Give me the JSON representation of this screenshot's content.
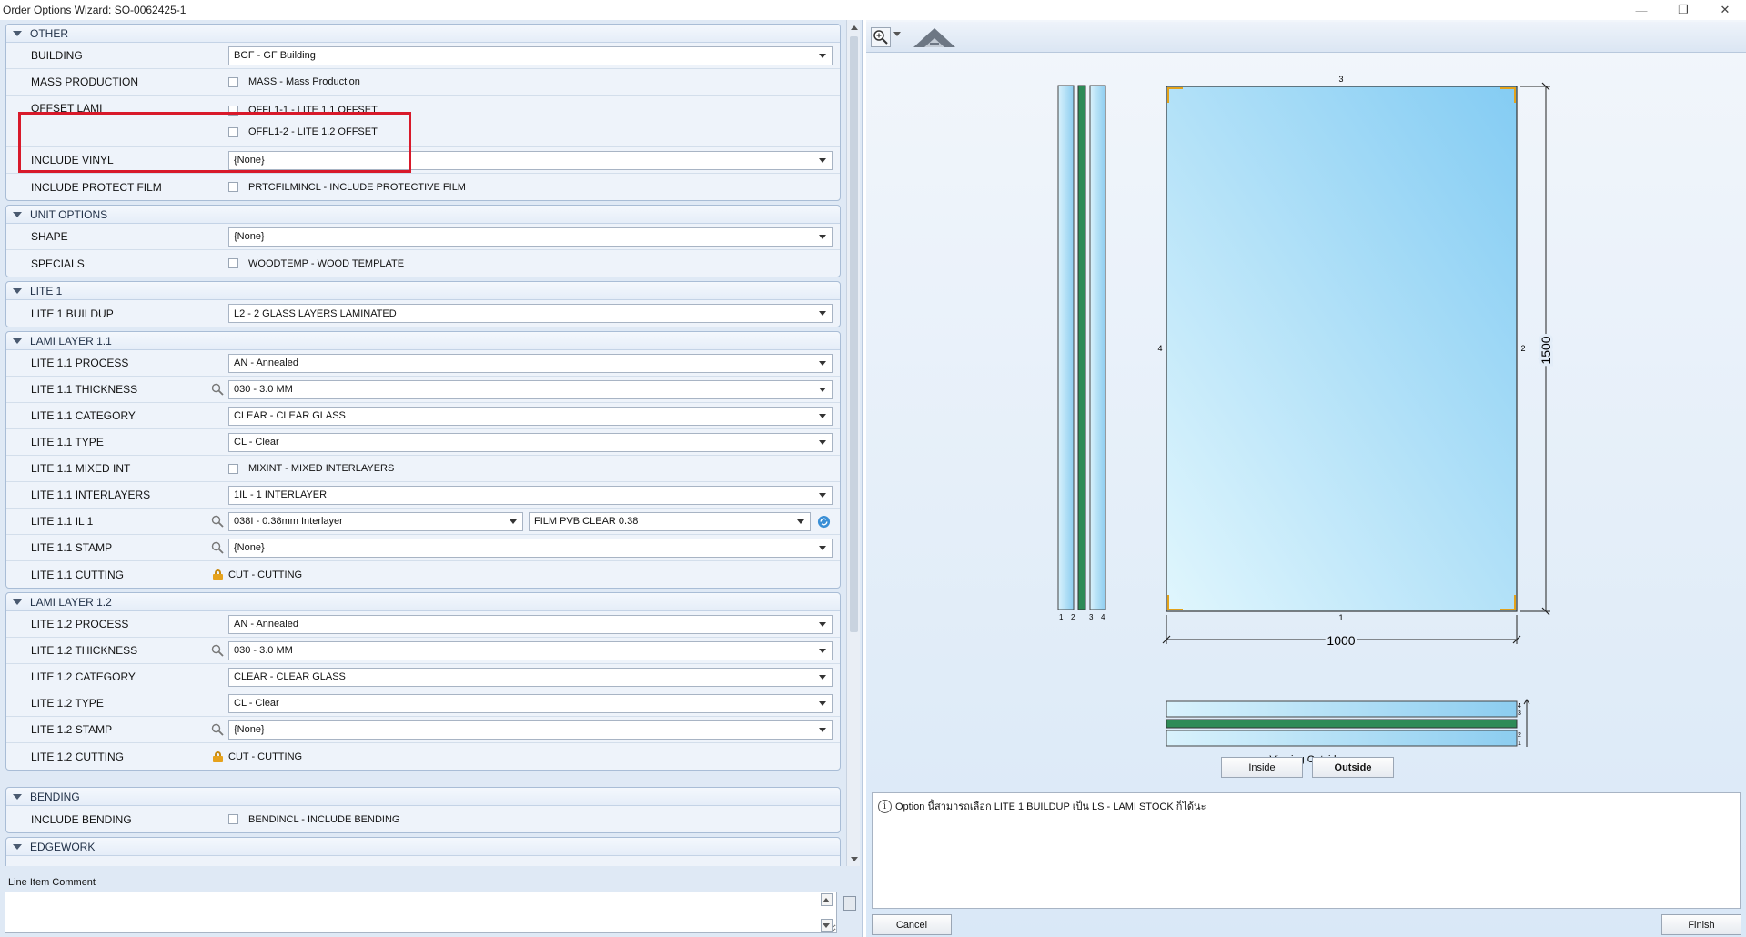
{
  "window": {
    "title": "Order Options Wizard: SO-0062425-1",
    "minimize": "—",
    "maximize": "❐",
    "close": "✕"
  },
  "groups": {
    "other": {
      "title": "OTHER",
      "building_label": "BUILDING",
      "building_value": "BGF - GF Building",
      "mass_label": "MASS PRODUCTION",
      "mass_option": "MASS - Mass Production",
      "offset_label": "OFFSET LAMI",
      "offset_option1": "OFFL1-1 - LITE 1.1 OFFSET",
      "offset_option2": "OFFL1-2 - LITE 1.2 OFFSET",
      "vinyl_label": "INCLUDE VINYL",
      "vinyl_value": "{None}",
      "film_label": "INCLUDE PROTECT FILM",
      "film_option": "PRTCFILMINCL - INCLUDE PROTECTIVE FILM"
    },
    "unit": {
      "title": "UNIT OPTIONS",
      "shape_label": "SHAPE",
      "shape_value": "{None}",
      "specials_label": "SPECIALS",
      "specials_option": "WOODTEMP - WOOD TEMPLATE"
    },
    "lite1": {
      "title": "LITE 1",
      "buildup_label": "LITE 1 BUILDUP",
      "buildup_value": "L2 - 2 GLASS LAYERS LAMINATED"
    },
    "lami11": {
      "title": "LAMI LAYER 1.1",
      "process_label": "LITE 1.1 PROCESS",
      "process_value": "AN - Annealed",
      "thickness_label": "LITE 1.1 THICKNESS",
      "thickness_value": "030 - 3.0 MM",
      "category_label": "LITE 1.1 CATEGORY",
      "category_value": "CLEAR - CLEAR GLASS",
      "type_label": "LITE 1.1 TYPE",
      "type_value": "CL - Clear",
      "mixed_label": "LITE 1.1 MIXED INT",
      "mixed_option": "MIXINT - MIXED INTERLAYERS",
      "interlayers_label": "LITE 1.1 INTERLAYERS",
      "interlayers_value": "1IL - 1 INTERLAYER",
      "il_label": "LITE 1.1 IL 1",
      "il_value": "038I - 0.38mm Interlayer",
      "il_film": "FILM PVB CLEAR 0.38",
      "stamp_label": "LITE 1.1 STAMP",
      "stamp_value": "{None}",
      "cutting_label": "LITE 1.1 CUTTING",
      "cutting_value": "CUT - CUTTING"
    },
    "lami12": {
      "title": "LAMI LAYER 1.2",
      "process_label": "LITE 1.2 PROCESS",
      "process_value": "AN - Annealed",
      "thickness_label": "LITE 1.2 THICKNESS",
      "thickness_value": "030 - 3.0 MM",
      "category_label": "LITE 1.2 CATEGORY",
      "category_value": "CLEAR - CLEAR GLASS",
      "type_label": "LITE 1.2 TYPE",
      "type_value": "CL - Clear",
      "stamp_label": "LITE 1.2 STAMP",
      "stamp_value": "{None}",
      "cutting_label": "LITE 1.2 CUTTING",
      "cutting_value": "CUT - CUTTING"
    },
    "bending": {
      "title": "BENDING",
      "include_label": "INCLUDE BENDING",
      "include_option": "BENDINCL - INCLUDE BENDING"
    },
    "edgework": {
      "title": "EDGEWORK"
    }
  },
  "comment": {
    "label": "Line Item Comment",
    "value": ""
  },
  "drawing": {
    "width_dim": "1000",
    "height_dim": "1500",
    "edge_top": "3",
    "edge_bottom": "1",
    "edge_left": "4",
    "edge_right": "2",
    "side_labels": [
      "1",
      "2",
      "3",
      "4"
    ],
    "stack_labels": [
      "4",
      "3",
      "2",
      "1"
    ],
    "viewing": "Viewing Outside",
    "glass_color": "#8ecff2",
    "interlayer_color": "#2e8b57",
    "corner_color": "#e3a21a"
  },
  "buttons": {
    "inside": "Inside",
    "outside": "Outside",
    "cancel": "Cancel",
    "finish": "Finish"
  },
  "info": {
    "message": "Option นี้สามารถเลือก LITE 1 BUILDUP เป็น  LS - LAMI STOCK ก็ได้นะ"
  },
  "colors": {
    "highlight": "#d8192a"
  }
}
